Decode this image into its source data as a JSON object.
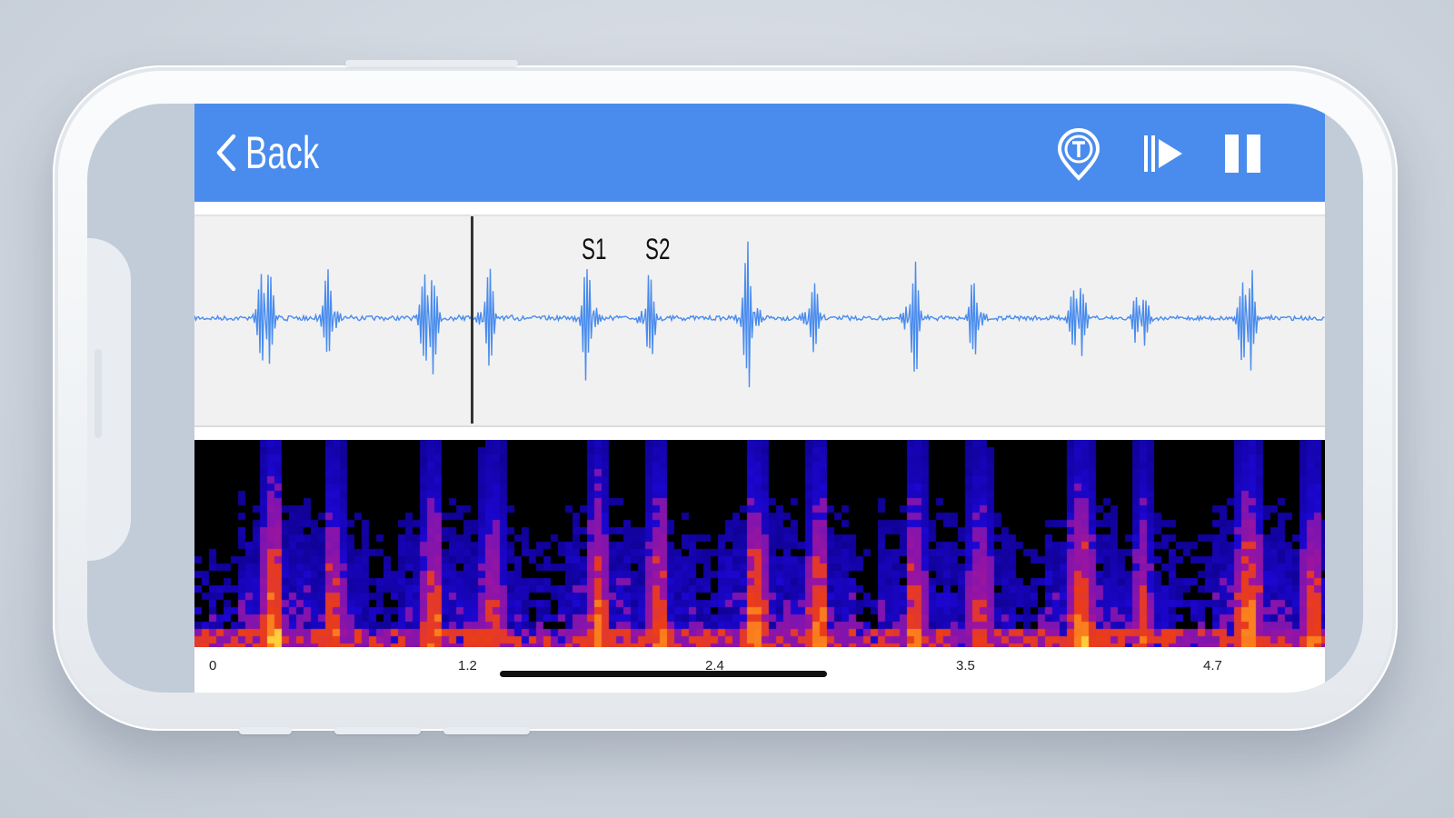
{
  "header": {
    "back_label": "Back",
    "icons": [
      "chevron-left-icon",
      "timer-marker-icon",
      "play-from-marker-icon",
      "pause-icon"
    ],
    "color": "#4a8ced"
  },
  "waveform": {
    "color": "#4a8ced",
    "markers": {
      "s1": "S1",
      "s2": "S2"
    }
  },
  "timeline": {
    "ticks": [
      "0",
      "1.2",
      "2.4",
      "3.5",
      "4.7"
    ]
  },
  "colors": {
    "background": "#ccd3dc",
    "waveform_bg": "#f1f1f2",
    "spectrogram_bg": "#000000"
  }
}
